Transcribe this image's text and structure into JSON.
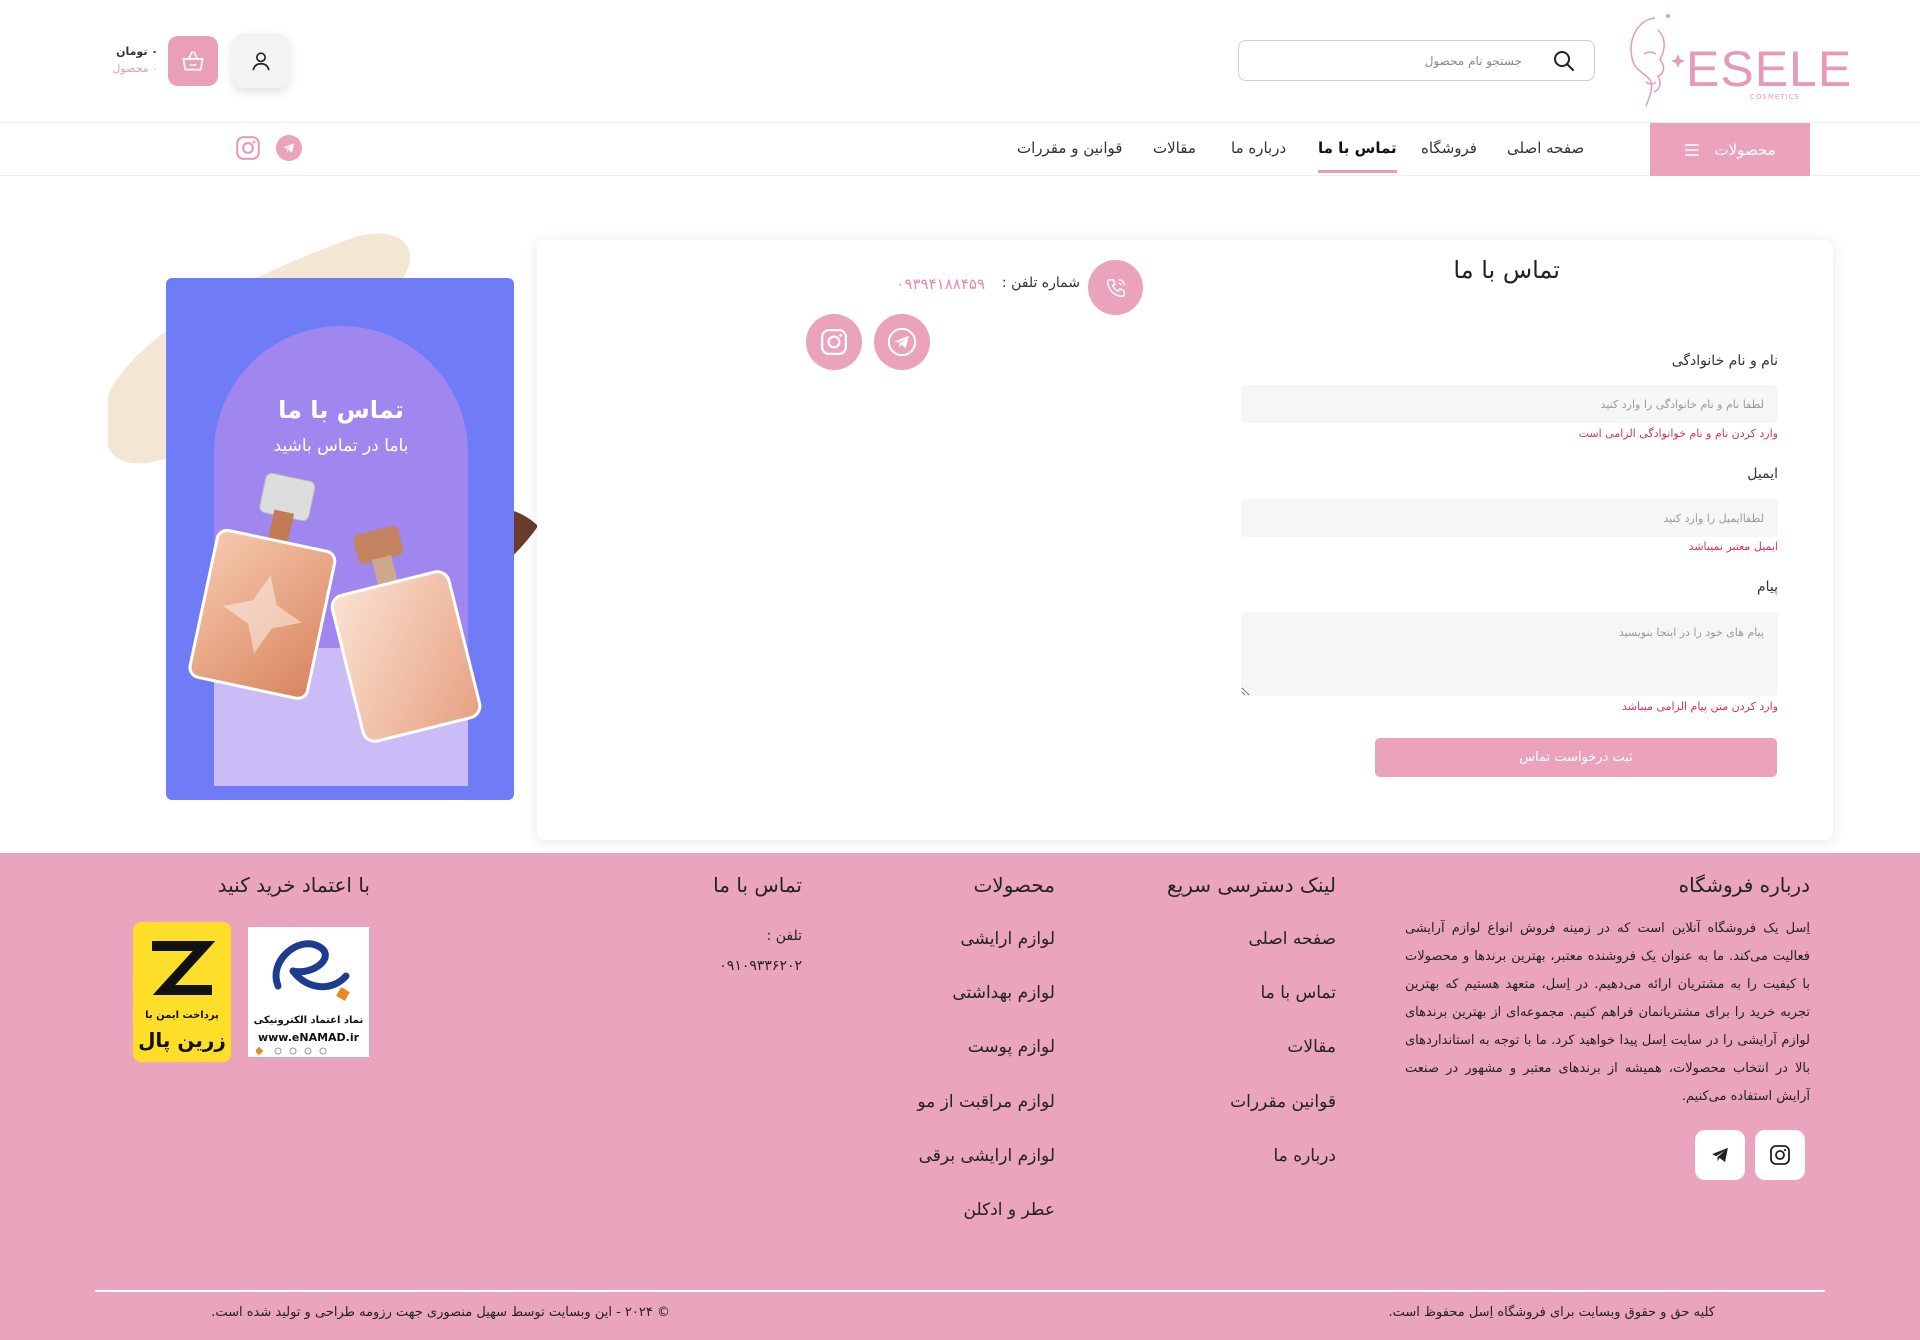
{
  "brand": {
    "name": "ESELE",
    "sub": "COSMETICS",
    "color": "#e59ab7"
  },
  "header": {
    "search_placeholder": "جستجو نام محصول",
    "cart_price": "۰ تومان",
    "cart_count": "۰ محصول"
  },
  "nav": {
    "products_label": "محصولات",
    "links": [
      {
        "label": "صفحه اصلی",
        "active": false
      },
      {
        "label": "فروشگاه",
        "active": false
      },
      {
        "label": "تماس با ما",
        "active": true
      },
      {
        "label": "درباره ما",
        "active": false
      },
      {
        "label": "مقالات",
        "active": false
      },
      {
        "label": "قوانین و مقررات",
        "active": false
      }
    ]
  },
  "banner": {
    "title": "تماس با ما",
    "subtitle": "باما در تماس باشید"
  },
  "contact": {
    "title": "تماس با ما",
    "phone_label": "شماره تلفن :",
    "phone": "۰۹۳۹۴۱۸۸۴۵۹",
    "form": {
      "name_label": "نام و نام خانوادگی",
      "name_placeholder": "لطفا نام و نام خانوادگی را وارد کنید",
      "name_error": "وارد کردن نام و نام خوانوادگی الزامی است",
      "email_label": "ایمیل",
      "email_placeholder": "لطفاایمیل را وارد کنید",
      "email_error": "ایمیل معتبر نمیباشد",
      "message_label": "پیام",
      "message_placeholder": "پیام های خود را در اینجا بنویسید",
      "message_error": "وارد کردن متن پیام الزامی میباشد",
      "submit": "ثبت درخواست تماس"
    }
  },
  "footer": {
    "about_title": "درباره فروشگاه",
    "about_text": "اِسل یک فروشگاه آنلاین است که در زمینه فروش انواع لوازم آرایشی فعالیت می‌کند. ما به عنوان یک فروشنده معتبر، بهترین برندها و محصولات با کیفیت را به مشتریان ارائه می‌دهیم. در اِسل، متعهد هستیم که بهترین تجربه خرید را برای مشتریانمان فراهم کنیم. مجموعه‌ای از بهترین برندهای لوازم آرایشی را در سایت اِسل پیدا خواهید کرد. ما با توجه به استانداردهای بالا در انتخاب محصولات، همیشه از برندهای معتبر و مشهور در صنعت آرایش استفاده می‌کنیم.",
    "quick_title": "لینک دسترسی سریع",
    "quick_links": [
      "صفحه اصلی",
      "تماس با ما",
      "مقالات",
      "قوانین مقررات",
      "درباره ما"
    ],
    "products_title": "محصولات",
    "product_links": [
      "لوازم ارایشی",
      "لوازم بهداشتی",
      "لوازم پوست",
      "لوازم مراقبت از مو",
      "لوازم ارایشی برقی",
      "عطر و ادکلن"
    ],
    "contact_title": "تماس با ما",
    "tel_label": "تلفن :",
    "tel": "۰۹۱۰۹۳۳۶۲۰۲",
    "trust_title": "با اعتماد خرید کنید",
    "enamad_line1": "نماد اعتماد الکترونیکی",
    "enamad_line2": "www.eNAMAD.ir",
    "zarinpal_line1": "پرداخت ایمن با",
    "zarinpal_line2": "زرین پال",
    "copyright_right": "کلیه حق و حقوق وبسایت برای فروشگاه اِسل محفوظ است.",
    "copyright_left": "© ۲۰۲۴ - این وبسایت توسط سهیل منصوری جهت رزومه طراحی و تولید شده است."
  },
  "colors": {
    "accent": "#eba3bc",
    "error": "#d8325a",
    "banner_blue": "#6f7cf6",
    "banner_purple": "#a087ef"
  }
}
